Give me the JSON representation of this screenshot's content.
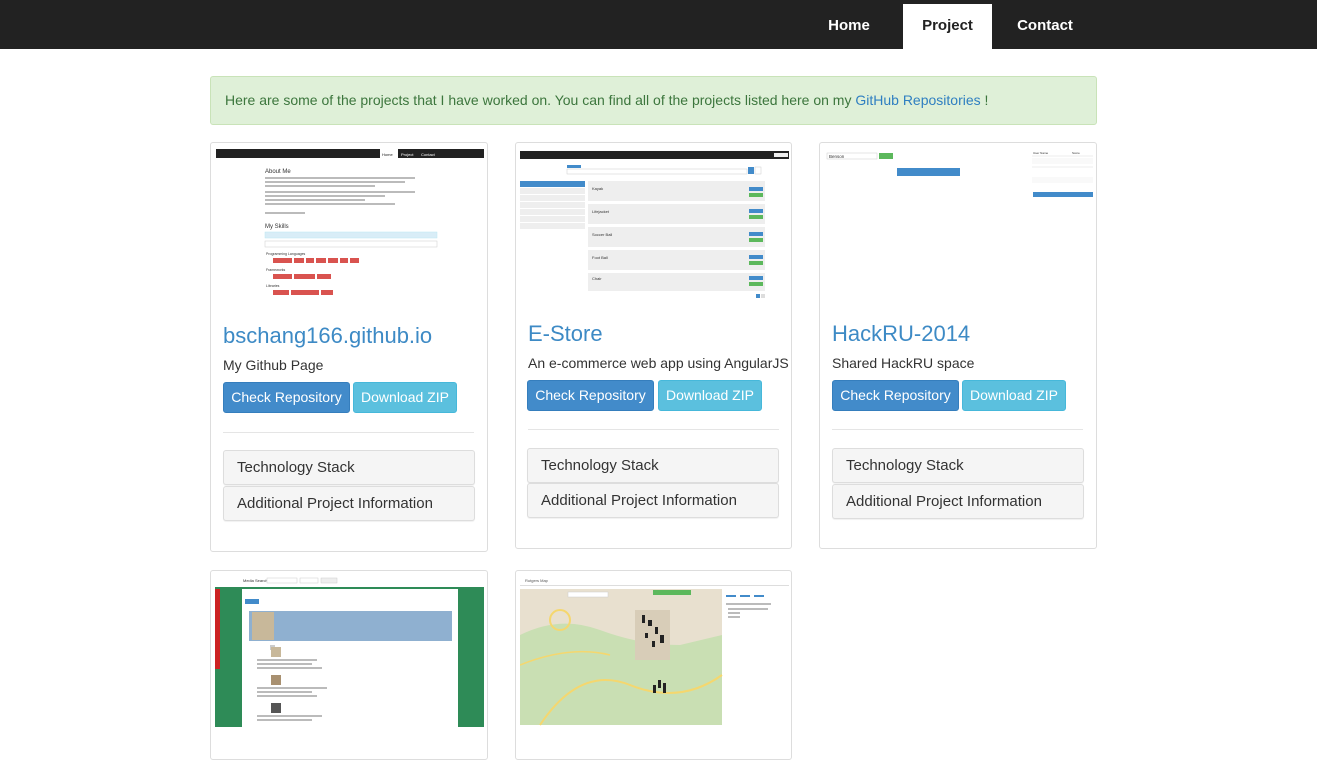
{
  "nav": {
    "items": [
      {
        "label": "Home",
        "active": false
      },
      {
        "label": "Project",
        "active": true
      },
      {
        "label": "Contact",
        "active": false
      }
    ]
  },
  "alert": {
    "text": "Here are some of the projects that I have worked on. You can find all of the projects listed here on my ",
    "link_text": "GitHub Repositories",
    "suffix": " !"
  },
  "projects": [
    {
      "title": "bschang166.github.io",
      "description": "My Github Page",
      "check_label": "Check Repository",
      "download_label": "Download ZIP",
      "tech_label": "Technology Stack",
      "info_label": "Additional Project Information"
    },
    {
      "title": "E-Store",
      "description": "An e-commerce web app using AngularJS",
      "check_label": "Check Repository",
      "download_label": "Download ZIP",
      "tech_label": "Technology Stack",
      "info_label": "Additional Project Information"
    },
    {
      "title": "HackRU-2014",
      "description": "Shared HackRU space",
      "check_label": "Check Repository",
      "download_label": "Download ZIP",
      "tech_label": "Technology Stack",
      "info_label": "Additional Project Information"
    }
  ],
  "thumbs": {
    "github": {
      "nav": [
        "Home",
        "Project",
        "Contact"
      ],
      "about": "About Me",
      "skills": "My Skills",
      "groups": [
        "Programming Languages",
        "Frameworks",
        "Libraries"
      ]
    },
    "estore": {
      "items": [
        "Kayak",
        "Lifejacket",
        "Soccer Ball",
        "Foot Ball",
        "Chair"
      ]
    },
    "hackru": {
      "name": "Benson",
      "col1": "User Name",
      "col2": "Score"
    },
    "media": {
      "title": "Media Search"
    },
    "map": {
      "title": "Rutgers Map"
    }
  },
  "colors": {
    "navbar": "#222222",
    "primary": "#428bca",
    "info": "#5bc0de",
    "alert_bg": "#dff0d8",
    "title": "#3d8ac5"
  }
}
